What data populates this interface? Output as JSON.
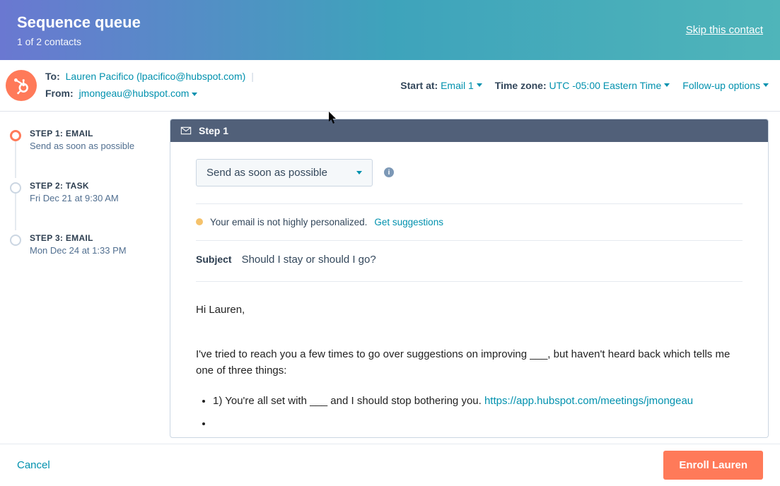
{
  "banner": {
    "title": "Sequence queue",
    "subtitle": "1 of 2 contacts",
    "skip_link": "Skip this contact"
  },
  "contact": {
    "to_label": "To:",
    "to_name": "Lauren Pacifico (lpacifico@hubspot.com)",
    "from_label": "From:",
    "from_value": "jmongeau@hubspot.com"
  },
  "settings": {
    "start_at_label": "Start at:",
    "start_at_value": "Email 1",
    "timezone_label": "Time zone:",
    "timezone_value": "UTC -05:00 Eastern Time",
    "followup_label": "Follow-up options"
  },
  "steps": [
    {
      "title": "STEP 1: EMAIL",
      "sub": "Send as soon as possible"
    },
    {
      "title": "STEP 2: TASK",
      "sub": "Fri Dec 21 at 9:30 AM"
    },
    {
      "title": "STEP 3: EMAIL",
      "sub": "Mon Dec 24 at 1:33 PM"
    }
  ],
  "editor": {
    "header": "Step 1",
    "when_select": "Send as soon as possible",
    "personalization_msg": "Your email is not highly personalized.",
    "suggestions_link": "Get suggestions",
    "subject_label": "Subject",
    "subject_value": "Should I stay or should I go?",
    "body_greeting": "Hi Lauren,",
    "body_p1": "I've tried to reach you a few times to go over suggestions on improving ___, but haven't heard back which tells me one of three things:",
    "body_li1_pre": "1) You're all set with ___ and I should stop bothering you. ",
    "body_li1_link": "https://app.hubspot.com/meetings/jmongeau"
  },
  "footer": {
    "cancel": "Cancel",
    "enroll": "Enroll Lauren"
  }
}
